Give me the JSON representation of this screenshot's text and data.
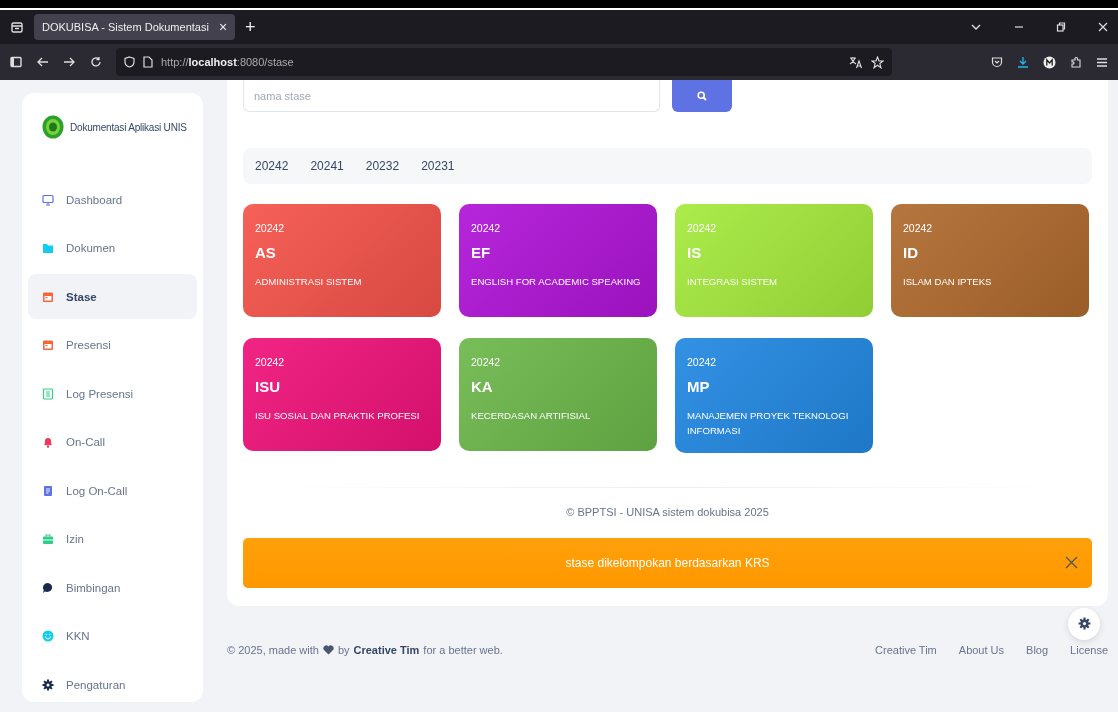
{
  "browser": {
    "tab_title": "DOKUBISA - Sistem Dokumentasi",
    "tab_close": "×",
    "new_tab": "+",
    "url": "http://**localhost**:8080/stase"
  },
  "sidebar": {
    "brand": "Dokumentasi Aplikasi UNIS",
    "items": [
      {
        "label": "Dashboard",
        "selected": false
      },
      {
        "label": "Dokumen",
        "selected": false
      },
      {
        "label": "Stase",
        "selected": true
      },
      {
        "label": "Presensi",
        "selected": false
      },
      {
        "label": "Log Presensi",
        "selected": false
      },
      {
        "label": "On-Call",
        "selected": false
      },
      {
        "label": "Log On-Call",
        "selected": false
      },
      {
        "label": "Izin",
        "selected": false
      },
      {
        "label": "Bimbingan",
        "selected": false
      },
      {
        "label": "KKN",
        "selected": false
      },
      {
        "label": "Pengaturan",
        "selected": false
      }
    ]
  },
  "search": {
    "placeholder": "nama stase"
  },
  "periods": [
    "20242",
    "20241",
    "20232",
    "20231"
  ],
  "cards": [
    {
      "period": "20242",
      "code": "AS",
      "name": "ADMINISTRASI SISTEM",
      "color": "#f5534a"
    },
    {
      "period": "20242",
      "code": "EF",
      "name": "ENGLISH FOR ACADEMIC SPEAKING",
      "color": "#b014d8"
    },
    {
      "period": "20242",
      "code": "IS",
      "name": "INTEGRASI SISTEM",
      "color": "#a5ea3c"
    },
    {
      "period": "20242",
      "code": "ID",
      "name": "ISLAM DAN IPTEKS",
      "color": "#b06a2e"
    },
    {
      "period": "20242",
      "code": "ISU",
      "name": "ISU SOSIAL DAN PRAKTIK PROFESI",
      "color": "#f0127a"
    },
    {
      "period": "20242",
      "code": "KA",
      "name": "KECERDASAN ARTIFISIAL",
      "color": "#6cb84a"
    },
    {
      "period": "20242",
      "code": "MP",
      "name": "MANAJEMEN PROYEK TEKNOLOGI INFORMASI",
      "color": "#2288e2"
    }
  ],
  "copyright": "© BPPTSI - UNISA sistem dokubisa 2025",
  "alert": {
    "message": "stase dikelompokan berdasarkan KRS"
  },
  "footer": {
    "made_with": "© 2025, made with",
    "by": "by",
    "author": "Creative Tim",
    "tail": "for a better web.",
    "links": [
      "Creative Tim",
      "About Us",
      "Blog",
      "License"
    ]
  }
}
